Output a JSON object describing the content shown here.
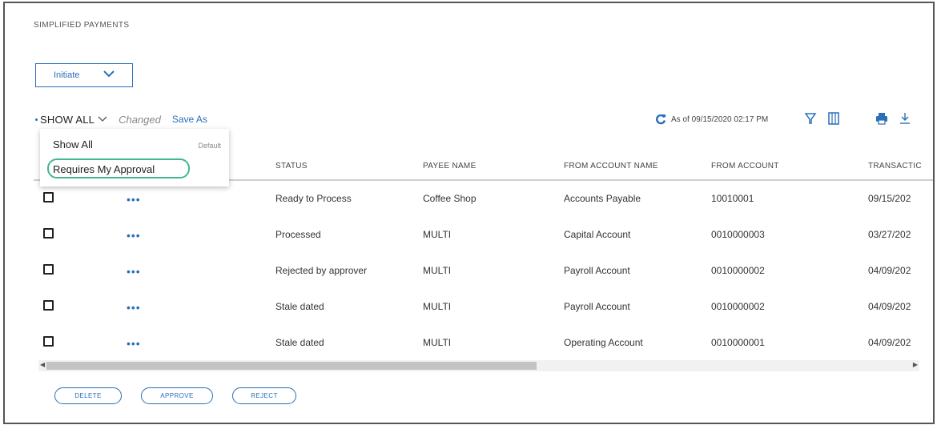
{
  "page": {
    "title": "SIMPLIFIED PAYMENTS"
  },
  "actions": {
    "initiate_label": "Initiate"
  },
  "toolbar": {
    "view_label": "SHOW ALL",
    "changed_label": "Changed",
    "save_as_label": "Save As",
    "as_of_text": "As of 09/15/2020 02:17 PM"
  },
  "view_menu": {
    "items": [
      {
        "label": "Show All",
        "badge": "Default"
      },
      {
        "label": "Requires My Approval",
        "badge": ""
      }
    ],
    "highlight_color": "#3fb98a"
  },
  "table": {
    "columns": [
      "STATUS",
      "PAYEE NAME",
      "FROM ACCOUNT NAME",
      "FROM ACCOUNT",
      "TRANSACTIC"
    ],
    "rows": [
      {
        "status": "Ready to Process",
        "payee": "Coffee Shop",
        "from_account_name": "Accounts Payable",
        "from_account": "10010001",
        "transaction_date": "09/15/202"
      },
      {
        "status": "Processed",
        "payee": "MULTI",
        "from_account_name": "Capital Account",
        "from_account": "0010000003",
        "transaction_date": "03/27/202"
      },
      {
        "status": "Rejected by approver",
        "payee": "MULTI",
        "from_account_name": "Payroll Account",
        "from_account": "0010000002",
        "transaction_date": "04/09/202"
      },
      {
        "status": "Stale dated",
        "payee": "MULTI",
        "from_account_name": "Payroll Account",
        "from_account": "0010000002",
        "transaction_date": "04/09/202"
      },
      {
        "status": "Stale dated",
        "payee": "MULTI",
        "from_account_name": "Operating Account",
        "from_account": "0010000001",
        "transaction_date": "04/09/202"
      }
    ],
    "row_actions_glyph": "•••"
  },
  "bulk_actions": {
    "delete_label": "DELETE",
    "approve_label": "APPROVE",
    "reject_label": "REJECT"
  },
  "icons": {
    "refresh": "refresh-icon",
    "filter": "filter-icon",
    "columns": "columns-icon",
    "print": "print-icon",
    "download": "download-icon"
  },
  "colors": {
    "accent": "#2a6fb8",
    "highlight": "#3fb98a"
  }
}
